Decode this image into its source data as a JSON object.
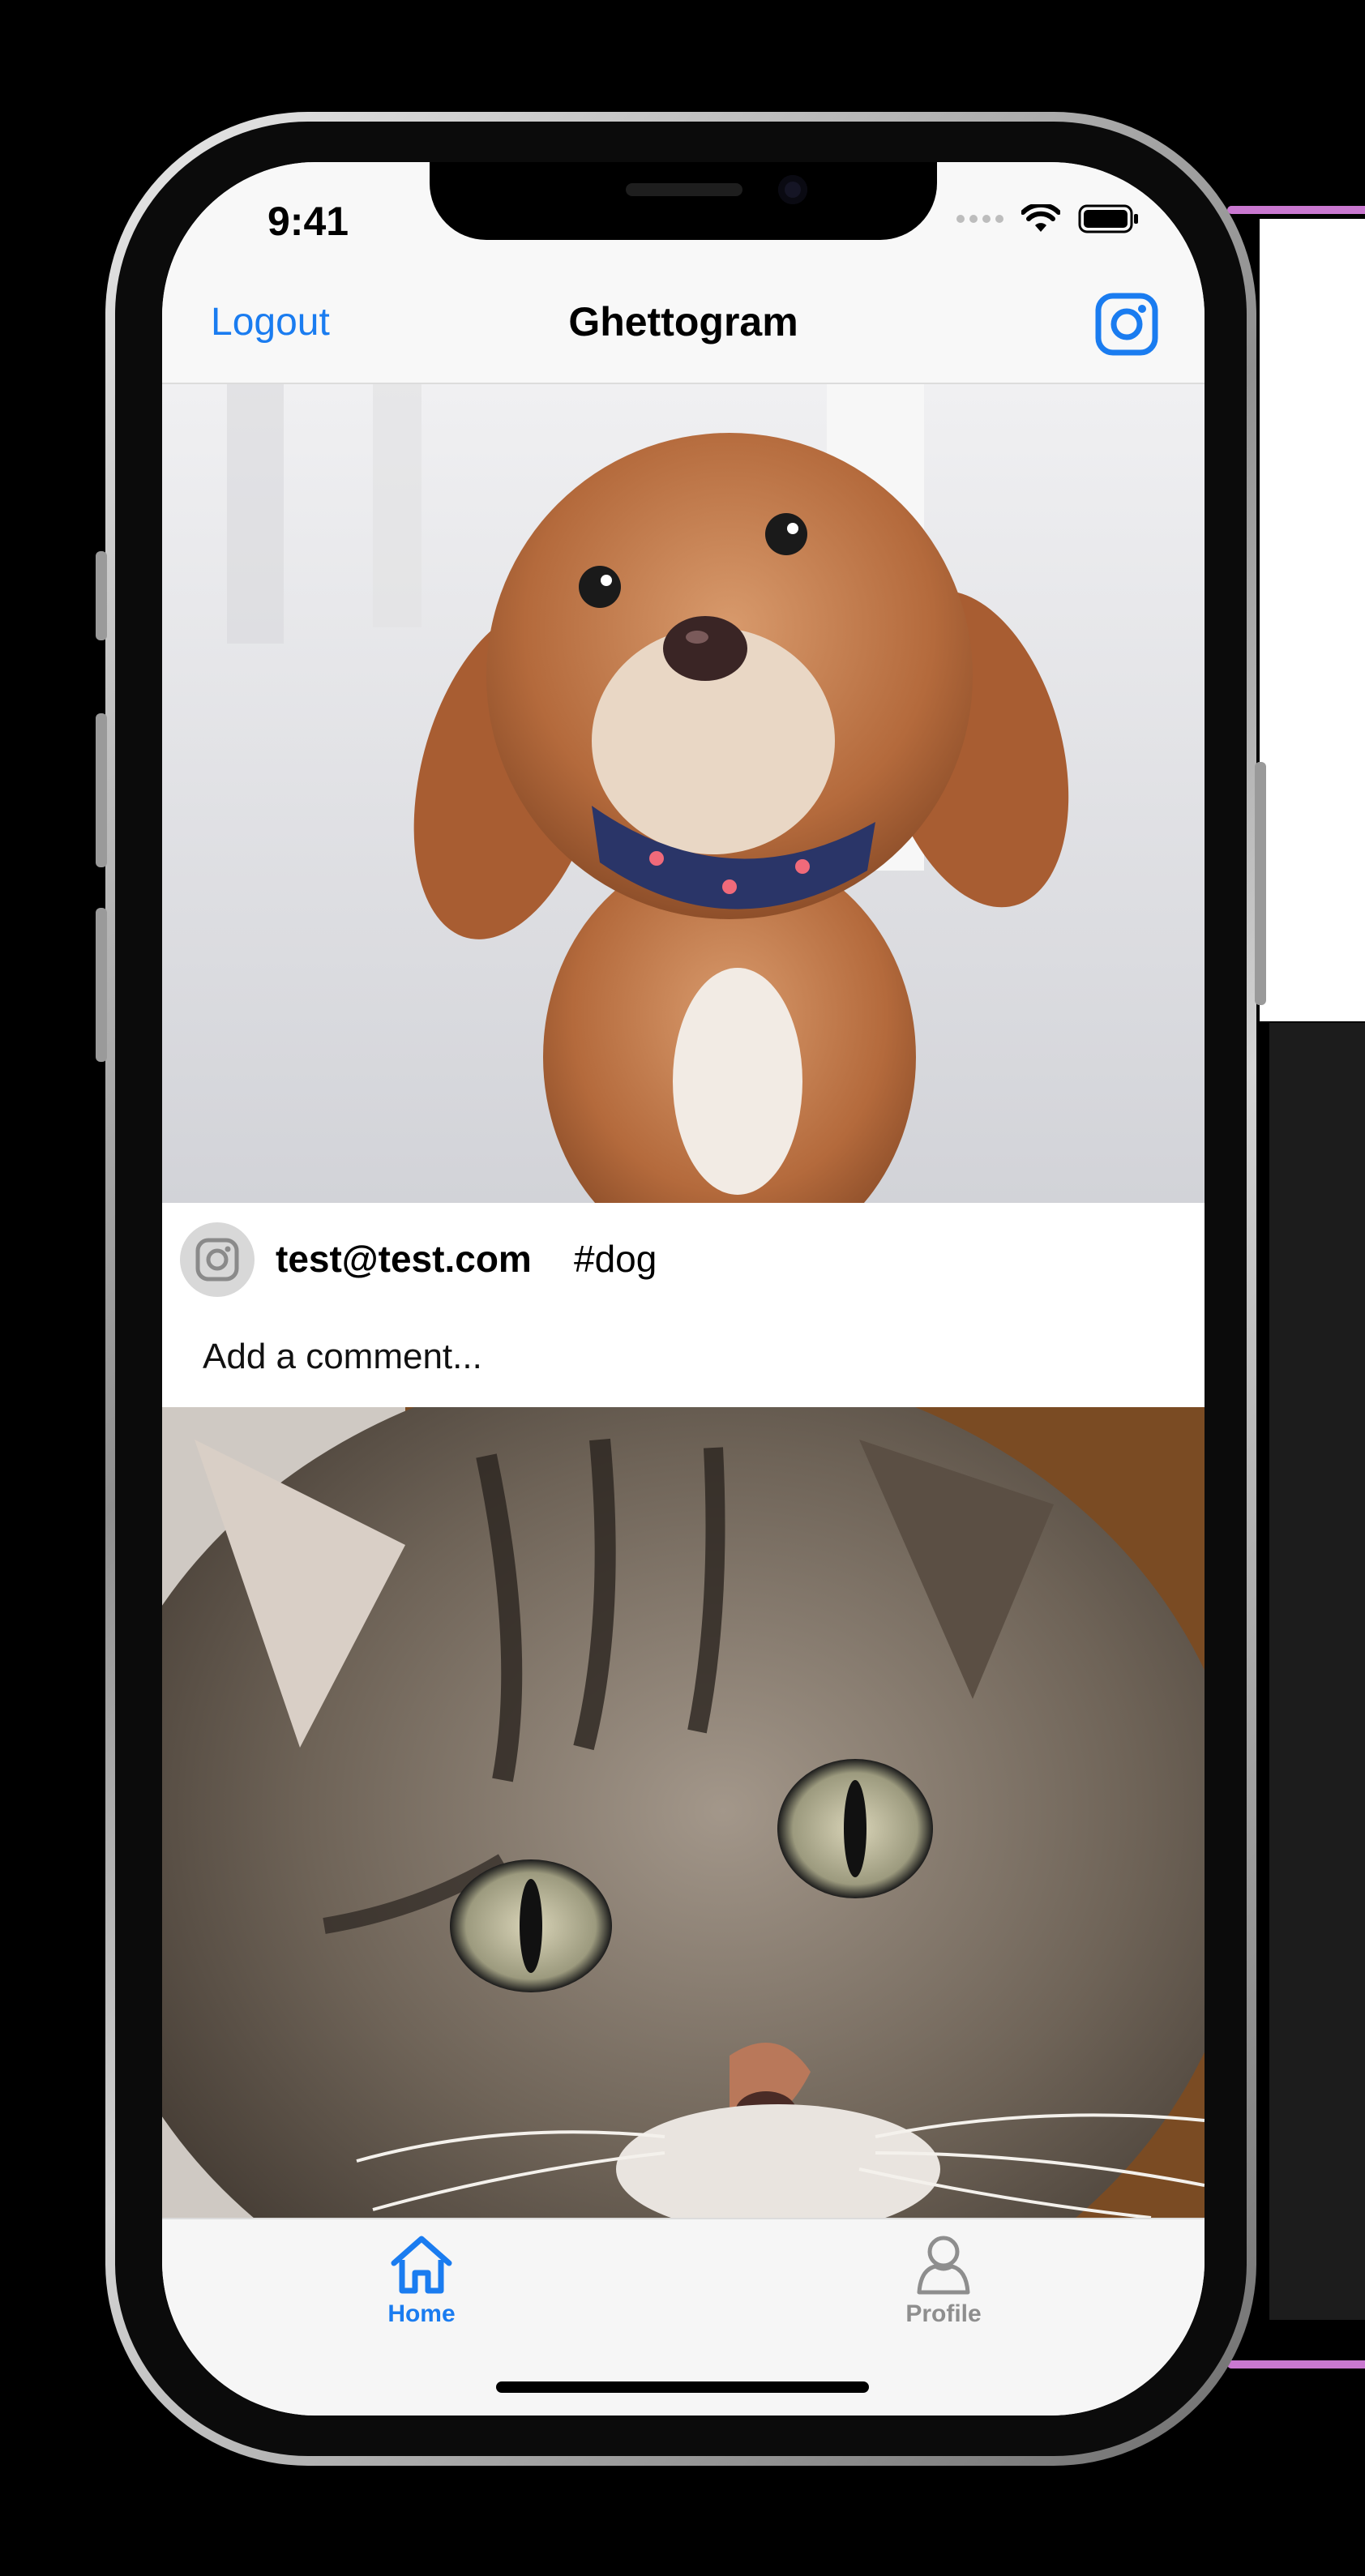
{
  "status_bar": {
    "time": "9:41"
  },
  "nav": {
    "left_button": "Logout",
    "title": "Ghettogram",
    "right_icon": "instagram-camera-icon"
  },
  "feed": {
    "posts": [
      {
        "image": "dog-photo",
        "user": "test@test.com",
        "tag": "#dog",
        "comment_placeholder": "Add a comment..."
      },
      {
        "image": "cat-photo"
      }
    ]
  },
  "tab_bar": {
    "items": [
      {
        "label": "Home",
        "icon": "house-icon",
        "selected": true
      },
      {
        "label": "Profile",
        "icon": "person-icon",
        "selected": false
      }
    ]
  },
  "colors": {
    "accent": "#1a7cf0",
    "inactive": "#8e8e8e",
    "text": "#000000",
    "background": "#ffffff"
  }
}
